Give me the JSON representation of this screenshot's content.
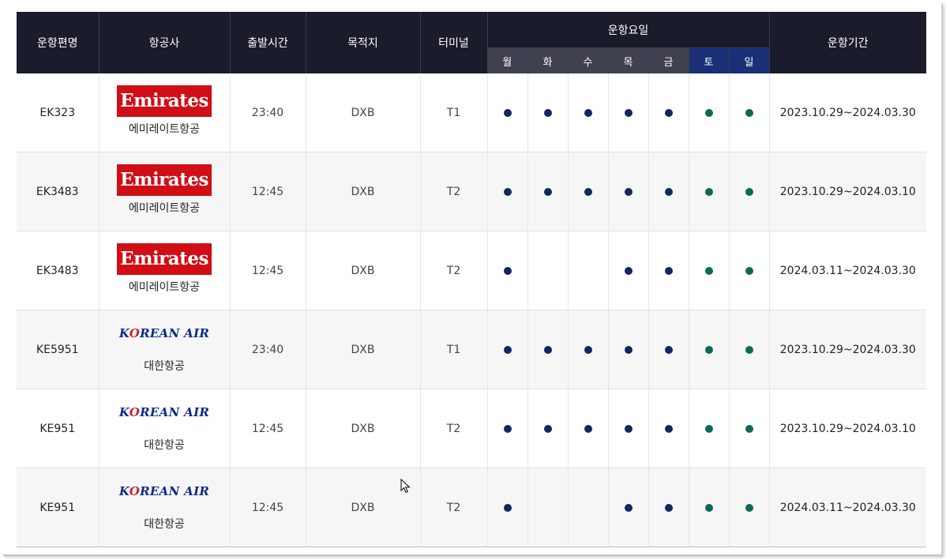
{
  "headers": {
    "flight": "운항편명",
    "airline": "항공사",
    "departure": "출발시간",
    "destination": "목적지",
    "terminal": "터미널",
    "days_group": "운항요일",
    "period": "운항기간",
    "days": [
      "월",
      "화",
      "수",
      "목",
      "금",
      "토",
      "일"
    ]
  },
  "colors": {
    "header_bg": "#1a1c2c",
    "day_header_bg": "#40414f",
    "weekend_header_bg": "#1b2f77",
    "weekday_dot": "#132661",
    "weekend_dot": "#0b6a57",
    "emirates_red": "#d10d15"
  },
  "rows": [
    {
      "flight": "EK323",
      "logo": "emirates",
      "logo_text": "Emirates",
      "airline": "에미레이트항공",
      "departure": "23:40",
      "destination": "DXB",
      "terminal": "T1",
      "days": [
        true,
        true,
        true,
        true,
        true,
        true,
        true
      ],
      "period": "2023.10.29~2024.03.30"
    },
    {
      "flight": "EK3483",
      "logo": "emirates",
      "logo_text": "Emirates",
      "airline": "에미레이트항공",
      "departure": "12:45",
      "destination": "DXB",
      "terminal": "T2",
      "days": [
        true,
        true,
        true,
        true,
        true,
        true,
        true
      ],
      "period": "2023.10.29~2024.03.10"
    },
    {
      "flight": "EK3483",
      "logo": "emirates",
      "logo_text": "Emirates",
      "airline": "에미레이트항공",
      "departure": "12:45",
      "destination": "DXB",
      "terminal": "T2",
      "days": [
        true,
        false,
        false,
        true,
        true,
        true,
        true
      ],
      "period": "2024.03.11~2024.03.30"
    },
    {
      "flight": "KE5951",
      "logo": "koreanair",
      "logo_text": "KOREAN AIR",
      "airline": "대한항공",
      "departure": "23:40",
      "destination": "DXB",
      "terminal": "T1",
      "days": [
        true,
        true,
        true,
        true,
        true,
        true,
        true
      ],
      "period": "2023.10.29~2024.03.30"
    },
    {
      "flight": "KE951",
      "logo": "koreanair",
      "logo_text": "KOREAN AIR",
      "airline": "대한항공",
      "departure": "12:45",
      "destination": "DXB",
      "terminal": "T2",
      "days": [
        true,
        true,
        true,
        true,
        true,
        true,
        true
      ],
      "period": "2023.10.29~2024.03.10"
    },
    {
      "flight": "KE951",
      "logo": "koreanair",
      "logo_text": "KOREAN AIR",
      "airline": "대한항공",
      "departure": "12:45",
      "destination": "DXB",
      "terminal": "T2",
      "days": [
        true,
        false,
        false,
        true,
        true,
        true,
        true
      ],
      "period": "2024.03.11~2024.03.30"
    }
  ]
}
